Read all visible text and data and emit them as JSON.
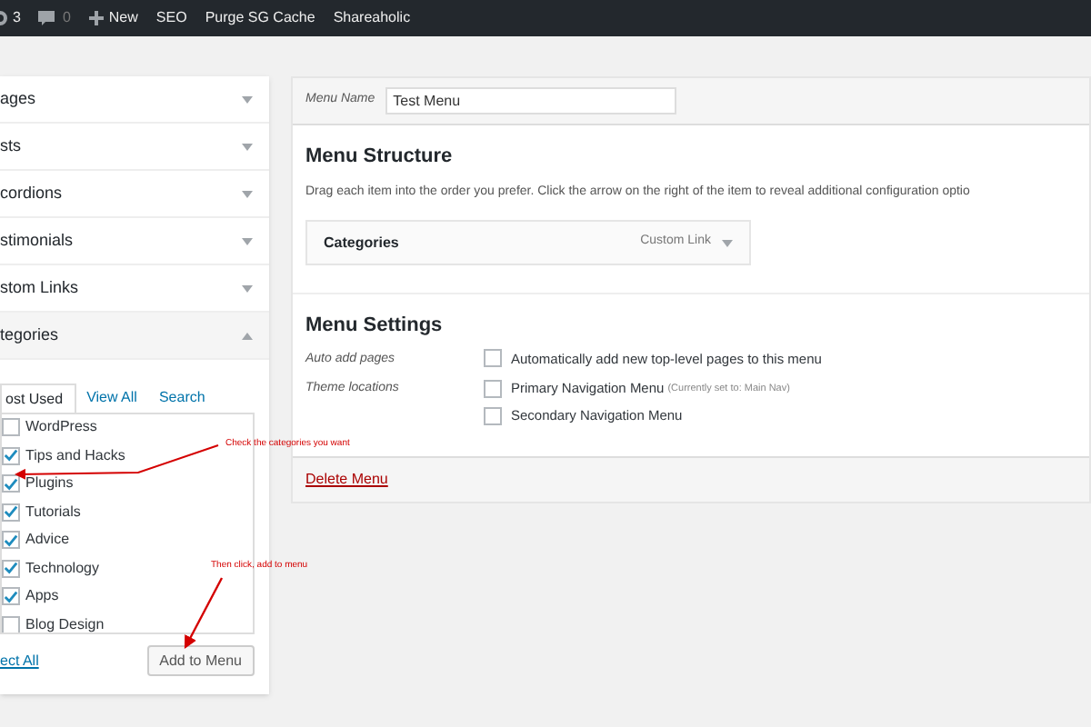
{
  "admin_bar": {
    "updates": "3",
    "comments": "0",
    "items": [
      "New",
      "SEO",
      "Purge SG Cache",
      "Shareaholic"
    ]
  },
  "accordion": [
    {
      "title": "ages",
      "expanded": false
    },
    {
      "title": "sts",
      "expanded": false
    },
    {
      "title": "cordions",
      "expanded": false
    },
    {
      "title": "stimonials",
      "expanded": false
    },
    {
      "title": "stom Links",
      "expanded": false
    },
    {
      "title": "tegories",
      "expanded": true
    }
  ],
  "category_tabs": [
    {
      "label": "ost Used",
      "selected": true
    },
    {
      "label": "View All",
      "selected": false
    },
    {
      "label": "Search",
      "selected": false
    }
  ],
  "categories": [
    {
      "label": "WordPress",
      "checked": false
    },
    {
      "label": "Tips and Hacks",
      "checked": true
    },
    {
      "label": "Plugins",
      "checked": true
    },
    {
      "label": "Tutorials",
      "checked": true
    },
    {
      "label": "Advice",
      "checked": true
    },
    {
      "label": "Technology",
      "checked": true
    },
    {
      "label": "Apps",
      "checked": true
    },
    {
      "label": "Blog Design",
      "checked": false
    }
  ],
  "select_all": "ect All",
  "add_button": "Add to Menu",
  "annotations": [
    "Check the categories you want",
    "Then click, add to menu"
  ],
  "menu_name": {
    "label": "Menu Name",
    "value": "Test Menu"
  },
  "structure": {
    "title": "Menu Structure",
    "description": "Drag each item into the order you prefer. Click the arrow on the right of the item to reveal additional configuration optio",
    "items": [
      {
        "title": "Categories",
        "type": "Custom Link"
      }
    ]
  },
  "settings": {
    "title": "Menu Settings",
    "auto_add": {
      "label": "Auto add pages",
      "options": [
        {
          "label": "Automatically add new top-level pages to this menu",
          "checked": false
        }
      ]
    },
    "locations": {
      "label": "Theme locations",
      "options": [
        {
          "label": "Primary Navigation Menu",
          "note": "(Currently set to: Main Nav)",
          "checked": false
        },
        {
          "label": "Secondary Navigation Menu",
          "checked": false
        }
      ]
    }
  },
  "delete_link": "Delete Menu"
}
